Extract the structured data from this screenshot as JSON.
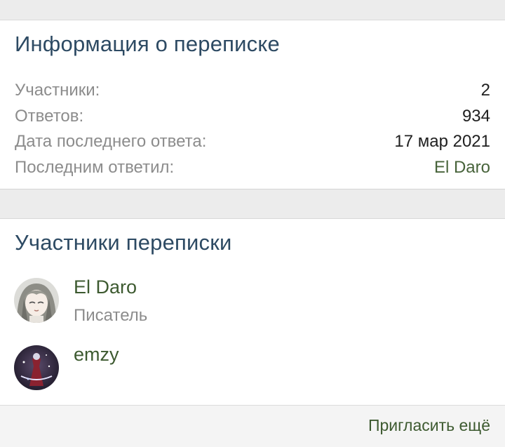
{
  "info": {
    "title": "Информация о переписке",
    "rows": [
      {
        "label": "Участники:",
        "value": "2"
      },
      {
        "label": "Ответов:",
        "value": "934"
      },
      {
        "label": "Дата последнего ответа:",
        "value": "17 мар 2021"
      },
      {
        "label": "Последним ответил:",
        "value": "El Daro"
      }
    ]
  },
  "participants": {
    "title": "Участники переписки",
    "members": [
      {
        "name": "El Daro",
        "user_title": "Писатель",
        "avatar": "anime-girl-avatar"
      },
      {
        "name": "emzy",
        "user_title": "",
        "avatar": "dark-figure-avatar"
      }
    ],
    "invite_label": "Пригласить ещё"
  },
  "colors": {
    "heading": "#2d4a63",
    "link": "#3d5a30",
    "muted": "#8c8c8c",
    "background": "#ececec"
  }
}
